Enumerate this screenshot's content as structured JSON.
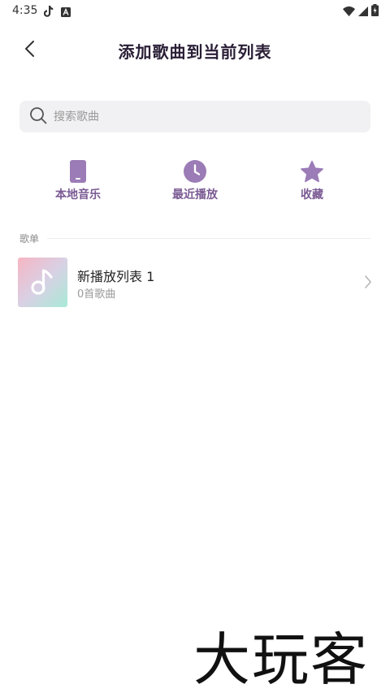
{
  "status_bar": {
    "time": "4:35",
    "left_icons": [
      "tiktok-icon",
      "a-notification-icon"
    ],
    "right_icons": [
      "wifi-icon",
      "cellular-signal-icon",
      "battery-charging-icon"
    ]
  },
  "header": {
    "title": "添加歌曲到当前列表",
    "back_icon": "chevron-left-icon"
  },
  "search": {
    "placeholder": "搜索歌曲",
    "icon": "search-icon"
  },
  "quick_actions": [
    {
      "label": "本地音乐",
      "icon": "phone-icon"
    },
    {
      "label": "最近播放",
      "icon": "clock-icon"
    },
    {
      "label": "收藏",
      "icon": "star-icon"
    }
  ],
  "section": {
    "title": "歌单"
  },
  "playlists": [
    {
      "name": "新播放列表 1",
      "count": "0首歌曲",
      "cover_icon": "music-note-icon",
      "chevron": "chevron-right-icon"
    }
  ],
  "watermark": {
    "text": "大玩客"
  },
  "colors": {
    "accent": "#7a5a93",
    "accent_icon": "#9b7cb6",
    "title": "#2a1f36",
    "search_bg": "#f1f1f3"
  }
}
